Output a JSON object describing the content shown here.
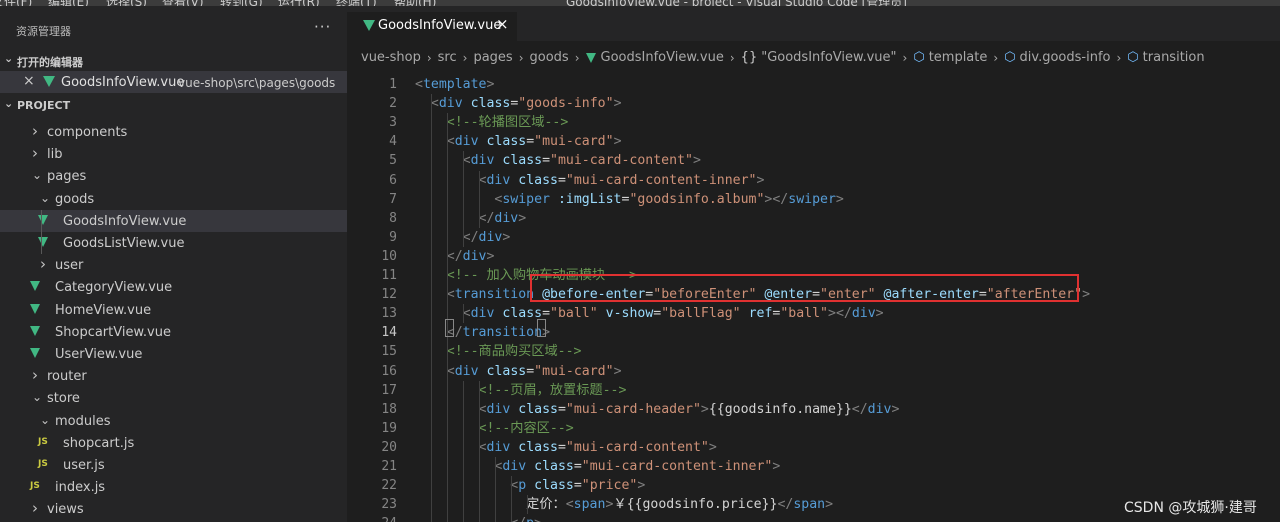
{
  "menubar": {
    "items": [
      "文件(F)",
      "编辑(E)",
      "选择(S)",
      "查看(V)",
      "转到(G)",
      "运行(R)",
      "终端(T)",
      "帮助(H)"
    ],
    "window_title": "GoodsInfoView.vue - project - Visual Studio Code [管理员]"
  },
  "sidebar": {
    "title": "资源管理器",
    "more": "···",
    "open_editors_header": "打开的编辑器",
    "open_editor": {
      "name": "GoodsInfoView.vue",
      "path": "vue-shop\\src\\pages\\goods"
    },
    "project_header": "PROJECT",
    "tree": [
      {
        "label": "components",
        "kind": "folder",
        "expanded": false,
        "depth": 2
      },
      {
        "label": "lib",
        "kind": "folder",
        "expanded": false,
        "depth": 2
      },
      {
        "label": "pages",
        "kind": "folder",
        "expanded": true,
        "depth": 2
      },
      {
        "label": "goods",
        "kind": "folder",
        "expanded": true,
        "depth": 3
      },
      {
        "label": "GoodsInfoView.vue",
        "kind": "vue",
        "depth": 4,
        "selected": true
      },
      {
        "label": "GoodsListView.vue",
        "kind": "vue",
        "depth": 4
      },
      {
        "label": "user",
        "kind": "folder",
        "expanded": false,
        "depth": 3
      },
      {
        "label": "CategoryView.vue",
        "kind": "vue",
        "depth": 3
      },
      {
        "label": "HomeView.vue",
        "kind": "vue",
        "depth": 3
      },
      {
        "label": "ShopcartView.vue",
        "kind": "vue",
        "depth": 3
      },
      {
        "label": "UserView.vue",
        "kind": "vue",
        "depth": 3
      },
      {
        "label": "router",
        "kind": "folder",
        "expanded": false,
        "depth": 2
      },
      {
        "label": "store",
        "kind": "folder",
        "expanded": true,
        "depth": 2
      },
      {
        "label": "modules",
        "kind": "folder",
        "expanded": true,
        "depth": 3
      },
      {
        "label": "shopcart.js",
        "kind": "js",
        "depth": 4
      },
      {
        "label": "user.js",
        "kind": "js",
        "depth": 4
      },
      {
        "label": "index.js",
        "kind": "js",
        "depth": 3
      },
      {
        "label": "views",
        "kind": "folder",
        "expanded": false,
        "depth": 2
      }
    ]
  },
  "editor": {
    "tab_label": "GoodsInfoView.vue",
    "breadcrumb": [
      "vue-shop",
      "src",
      "pages",
      "goods",
      "GoodsInfoView.vue",
      "\"GoodsInfoView.vue\"",
      "template",
      "div.goods-info",
      "transition"
    ],
    "current_line": 14,
    "lines": [
      [
        [
          "t",
          "<"
        ],
        [
          "tn",
          "template"
        ],
        [
          "t",
          ">"
        ]
      ],
      [
        [
          "tx",
          "  "
        ],
        [
          "t",
          "<"
        ],
        [
          "tn",
          "div"
        ],
        [
          "tx",
          " "
        ],
        [
          "at",
          "class"
        ],
        [
          "tx",
          "="
        ],
        [
          "st",
          "\"goods-info\""
        ],
        [
          "t",
          ">"
        ]
      ],
      [
        [
          "tx",
          "    "
        ],
        [
          "cm",
          "<!--轮播图区域-->"
        ]
      ],
      [
        [
          "tx",
          "    "
        ],
        [
          "t",
          "<"
        ],
        [
          "tn",
          "div"
        ],
        [
          "tx",
          " "
        ],
        [
          "at",
          "class"
        ],
        [
          "tx",
          "="
        ],
        [
          "st",
          "\"mui-card\""
        ],
        [
          "t",
          ">"
        ]
      ],
      [
        [
          "tx",
          "      "
        ],
        [
          "t",
          "<"
        ],
        [
          "tn",
          "div"
        ],
        [
          "tx",
          " "
        ],
        [
          "at",
          "class"
        ],
        [
          "tx",
          "="
        ],
        [
          "st",
          "\"mui-card-content\""
        ],
        [
          "t",
          ">"
        ]
      ],
      [
        [
          "tx",
          "        "
        ],
        [
          "t",
          "<"
        ],
        [
          "tn",
          "div"
        ],
        [
          "tx",
          " "
        ],
        [
          "at",
          "class"
        ],
        [
          "tx",
          "="
        ],
        [
          "st",
          "\"mui-card-content-inner\""
        ],
        [
          "t",
          ">"
        ]
      ],
      [
        [
          "tx",
          "          "
        ],
        [
          "t",
          "<"
        ],
        [
          "tn",
          "swiper"
        ],
        [
          "tx",
          " "
        ],
        [
          "at",
          ":imgList"
        ],
        [
          "tx",
          "="
        ],
        [
          "st",
          "\"goodsinfo.album\""
        ],
        [
          "t",
          "></"
        ],
        [
          "tn",
          "swiper"
        ],
        [
          "t",
          ">"
        ]
      ],
      [
        [
          "tx",
          "        "
        ],
        [
          "t",
          "</"
        ],
        [
          "tn",
          "div"
        ],
        [
          "t",
          ">"
        ]
      ],
      [
        [
          "tx",
          "      "
        ],
        [
          "t",
          "</"
        ],
        [
          "tn",
          "div"
        ],
        [
          "t",
          ">"
        ]
      ],
      [
        [
          "tx",
          "    "
        ],
        [
          "t",
          "</"
        ],
        [
          "tn",
          "div"
        ],
        [
          "t",
          ">"
        ]
      ],
      [
        [
          "tx",
          "    "
        ],
        [
          "cm",
          "<!-- 加入购物车动画模块 -->"
        ]
      ],
      [
        [
          "tx",
          "    "
        ],
        [
          "t",
          "<"
        ],
        [
          "tn",
          "transition"
        ],
        [
          "tx",
          " "
        ],
        [
          "at",
          "@before-enter"
        ],
        [
          "tx",
          "="
        ],
        [
          "st",
          "\"beforeEnter\""
        ],
        [
          "tx",
          " "
        ],
        [
          "at",
          "@enter"
        ],
        [
          "tx",
          "="
        ],
        [
          "st",
          "\"enter\""
        ],
        [
          "tx",
          " "
        ],
        [
          "at",
          "@after-enter"
        ],
        [
          "tx",
          "="
        ],
        [
          "st",
          "\"afterEnter\""
        ],
        [
          "t",
          ">"
        ]
      ],
      [
        [
          "tx",
          "      "
        ],
        [
          "t",
          "<"
        ],
        [
          "tn",
          "div"
        ],
        [
          "tx",
          " "
        ],
        [
          "at",
          "class"
        ],
        [
          "tx",
          "="
        ],
        [
          "st",
          "\"ball\""
        ],
        [
          "tx",
          " "
        ],
        [
          "at",
          "v-show"
        ],
        [
          "tx",
          "="
        ],
        [
          "st",
          "\"ballFlag\""
        ],
        [
          "tx",
          " "
        ],
        [
          "at",
          "ref"
        ],
        [
          "tx",
          "="
        ],
        [
          "st",
          "\"ball\""
        ],
        [
          "t",
          "></"
        ],
        [
          "tn",
          "div"
        ],
        [
          "t",
          ">"
        ]
      ],
      [
        [
          "tx",
          "    "
        ],
        [
          "t",
          "</"
        ],
        [
          "tn",
          "transition"
        ],
        [
          "t",
          ">"
        ]
      ],
      [
        [
          "tx",
          "    "
        ],
        [
          "cm",
          "<!--商品购买区域-->"
        ]
      ],
      [
        [
          "tx",
          "    "
        ],
        [
          "t",
          "<"
        ],
        [
          "tn",
          "div"
        ],
        [
          "tx",
          " "
        ],
        [
          "at",
          "class"
        ],
        [
          "tx",
          "="
        ],
        [
          "st",
          "\"mui-card\""
        ],
        [
          "t",
          ">"
        ]
      ],
      [
        [
          "tx",
          "        "
        ],
        [
          "cm",
          "<!--页眉，放置标题-->"
        ]
      ],
      [
        [
          "tx",
          "        "
        ],
        [
          "t",
          "<"
        ],
        [
          "tn",
          "div"
        ],
        [
          "tx",
          " "
        ],
        [
          "at",
          "class"
        ],
        [
          "tx",
          "="
        ],
        [
          "st",
          "\"mui-card-header\""
        ],
        [
          "t",
          ">"
        ],
        [
          "tx",
          "{{goodsinfo.name}}"
        ],
        [
          "t",
          "</"
        ],
        [
          "tn",
          "div"
        ],
        [
          "t",
          ">"
        ]
      ],
      [
        [
          "tx",
          "        "
        ],
        [
          "cm",
          "<!--内容区-->"
        ]
      ],
      [
        [
          "tx",
          "        "
        ],
        [
          "t",
          "<"
        ],
        [
          "tn",
          "div"
        ],
        [
          "tx",
          " "
        ],
        [
          "at",
          "class"
        ],
        [
          "tx",
          "="
        ],
        [
          "st",
          "\"mui-card-content\""
        ],
        [
          "t",
          ">"
        ]
      ],
      [
        [
          "tx",
          "          "
        ],
        [
          "t",
          "<"
        ],
        [
          "tn",
          "div"
        ],
        [
          "tx",
          " "
        ],
        [
          "at",
          "class"
        ],
        [
          "tx",
          "="
        ],
        [
          "st",
          "\"mui-card-content-inner\""
        ],
        [
          "t",
          ">"
        ]
      ],
      [
        [
          "tx",
          "            "
        ],
        [
          "t",
          "<"
        ],
        [
          "tn",
          "p"
        ],
        [
          "tx",
          " "
        ],
        [
          "at",
          "class"
        ],
        [
          "tx",
          "="
        ],
        [
          "st",
          "\"price\""
        ],
        [
          "t",
          ">"
        ]
      ],
      [
        [
          "tx",
          "              定价："
        ],
        [
          "t",
          "<"
        ],
        [
          "tn",
          "span"
        ],
        [
          "t",
          ">"
        ],
        [
          "tx",
          "￥{{goodsinfo.price}}"
        ],
        [
          "t",
          "</"
        ],
        [
          "tn",
          "span"
        ],
        [
          "t",
          ">"
        ]
      ],
      [
        [
          "tx",
          "            "
        ],
        [
          "t",
          "</"
        ],
        [
          "tn",
          "p"
        ],
        [
          "t",
          ">"
        ]
      ]
    ]
  },
  "watermark": "CSDN @攻城狮·建哥",
  "colors": {
    "vue_logo": "#41b883",
    "highlight_box": "#e03131",
    "tag": "#569cd6",
    "attribute": "#9cdcfe",
    "string": "#ce9178",
    "comment": "#6a9955"
  }
}
